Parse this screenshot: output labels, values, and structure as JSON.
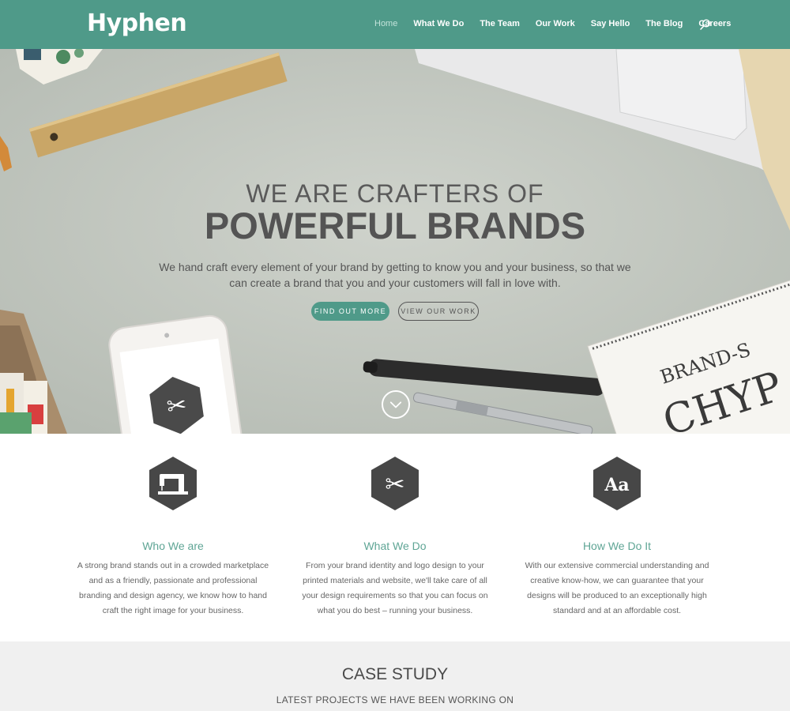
{
  "brand": {
    "logo_text": "Hyphen",
    "accent": "#4f9a89"
  },
  "nav": {
    "items": [
      {
        "label": "Home",
        "active": true
      },
      {
        "label": "What We Do",
        "active": false
      },
      {
        "label": "The Team",
        "active": false
      },
      {
        "label": "Our Work",
        "active": false
      },
      {
        "label": "Say Hello",
        "active": false
      },
      {
        "label": "The Blog",
        "active": false
      },
      {
        "label": "Careers",
        "active": false
      }
    ],
    "search_icon": "search-icon"
  },
  "hero": {
    "headline_top": "WE ARE CRAFTERS OF",
    "headline_main": "POWERFUL BRANDS",
    "text": "We hand craft every element of your brand by getting to know you and your business, so that we can create a brand that you and your customers will fall in love with.",
    "cta_primary": "FIND OUT MORE",
    "cta_secondary": "VIEW OUR WORK",
    "scroll_icon": "chevron-down-icon",
    "notebook_text": "BRAND-S",
    "notebook_large": "CHYP"
  },
  "features": [
    {
      "icon": "sewing-machine-icon",
      "title": "Who We are",
      "text": "A strong brand stands out in a crowded marketplace and as a friendly, passionate and professional branding and design agency, we know how to hand craft the right image for your business."
    },
    {
      "icon": "scissors-icon",
      "title": "What We Do",
      "text": "From your brand identity and logo design to your printed materials and website, we'll take care of all your design requirements so that you can focus on what you do best – running your business."
    },
    {
      "icon": "typography-icon",
      "icon_text": "Aa",
      "title": "How We Do It",
      "text": "With our extensive commercial understanding and creative know-how, we can guarantee that your designs will be produced to an exceptionally high standard and at an affordable cost."
    }
  ],
  "case_study": {
    "title": "CASE STUDY",
    "subtitle": "LATEST PROJECTS WE HAVE BEEN WORKING ON"
  }
}
